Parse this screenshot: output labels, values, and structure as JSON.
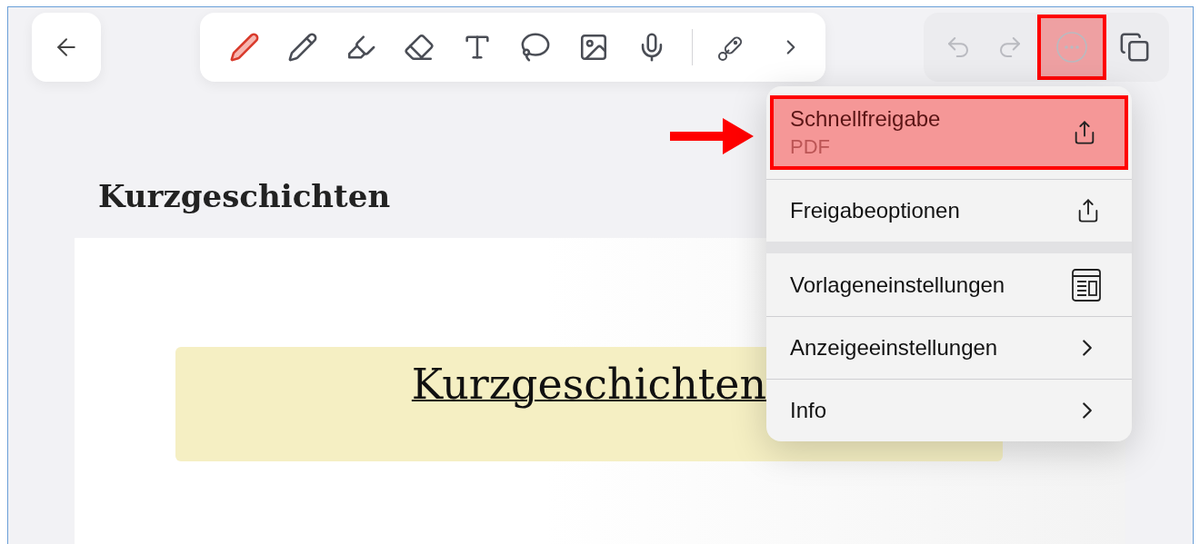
{
  "toolbar": {
    "tools": [
      {
        "kind": "pen",
        "selected": true
      },
      {
        "kind": "pencil",
        "selected": false
      },
      {
        "kind": "highlighter",
        "selected": false
      },
      {
        "kind": "eraser",
        "selected": false
      },
      {
        "kind": "text",
        "selected": false
      },
      {
        "kind": "lasso",
        "selected": false
      },
      {
        "kind": "image",
        "selected": false
      },
      {
        "kind": "mic",
        "selected": false
      },
      {
        "kind": "divider"
      },
      {
        "kind": "laser",
        "selected": false
      },
      {
        "kind": "more",
        "selected": false
      }
    ]
  },
  "actions": [
    {
      "kind": "undo",
      "disabled": true,
      "highlighted": false
    },
    {
      "kind": "redo",
      "disabled": true,
      "highlighted": false
    },
    {
      "kind": "more",
      "disabled": true,
      "highlighted": true
    },
    {
      "kind": "pages",
      "disabled": false,
      "highlighted": false
    }
  ],
  "document": {
    "title": "Kurzgeschichten",
    "heading": "Kurzgeschichten"
  },
  "menu": {
    "groups": [
      [
        {
          "label": "Schnellfreigabe",
          "sublabel": "PDF",
          "kind": "share",
          "highlighted": true
        },
        {
          "label": "Freigabeoptionen",
          "kind": "share",
          "highlighted": false
        }
      ],
      [
        {
          "label": "Vorlageneinstellungen",
          "kind": "template",
          "highlighted": false
        },
        {
          "label": "Anzeigeeinstellungen",
          "kind": "submenu",
          "highlighted": false
        },
        {
          "label": "Info",
          "kind": "submenu",
          "highlighted": false
        }
      ]
    ]
  }
}
